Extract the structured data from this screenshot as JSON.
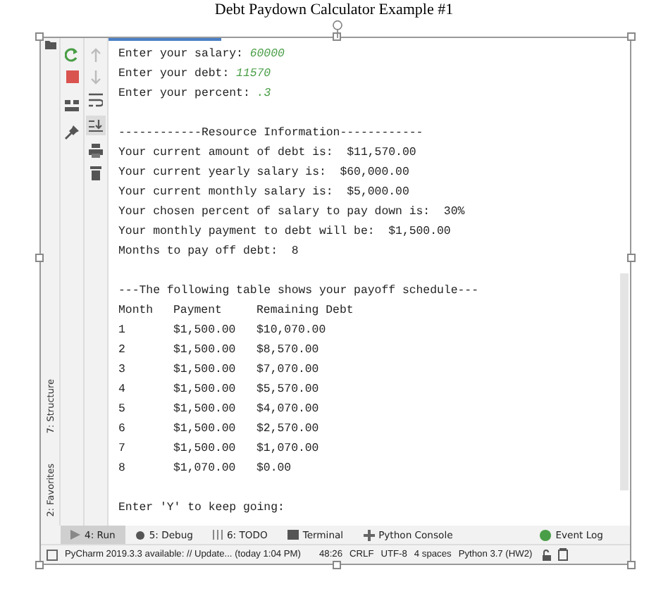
{
  "title": "Debt Paydown Calculator Example #1",
  "side_tabs": [
    {
      "label": "7: Structure"
    },
    {
      "label": "2: Favorites"
    }
  ],
  "console": {
    "lines": [
      {
        "kind": "prompt",
        "text": "Enter your salary: ",
        "input": "60000"
      },
      {
        "kind": "prompt",
        "text": "Enter your debt: ",
        "input": "11570"
      },
      {
        "kind": "prompt",
        "text": "Enter your percent: ",
        "input": ".3"
      },
      {
        "kind": "blank"
      },
      {
        "kind": "output",
        "text": "------------Resource Information------------"
      },
      {
        "kind": "output",
        "text": "Your current amount of debt is:  $11,570.00"
      },
      {
        "kind": "output",
        "text": "Your current yearly salary is:  $60,000.00"
      },
      {
        "kind": "output",
        "text": "Your current monthly salary is:  $5,000.00"
      },
      {
        "kind": "output",
        "text": "Your chosen percent of salary to pay down is:  30%"
      },
      {
        "kind": "output",
        "text": "Your monthly payment to debt will be:  $1,500.00"
      },
      {
        "kind": "output",
        "text": "Months to pay off debt:  8"
      },
      {
        "kind": "blank"
      },
      {
        "kind": "output",
        "text": "---The following table shows your payoff schedule---"
      }
    ],
    "table": {
      "columns": [
        "Month",
        "Payment",
        "Remaining Debt"
      ],
      "rows": [
        [
          "1",
          "$1,500.00",
          "$10,070.00"
        ],
        [
          "2",
          "$1,500.00",
          "$8,570.00"
        ],
        [
          "3",
          "$1,500.00",
          "$7,070.00"
        ],
        [
          "4",
          "$1,500.00",
          "$5,570.00"
        ],
        [
          "5",
          "$1,500.00",
          "$4,070.00"
        ],
        [
          "6",
          "$1,500.00",
          "$2,570.00"
        ],
        [
          "7",
          "$1,500.00",
          "$1,070.00"
        ],
        [
          "8",
          "$1,070.00",
          "$0.00"
        ]
      ]
    },
    "last_prompt": "Enter 'Y' to keep going:"
  },
  "tool_tabs": [
    {
      "label": "4: Run",
      "selected": true
    },
    {
      "label": "5: Debug",
      "selected": false
    },
    {
      "label": "6: TODO",
      "selected": false
    },
    {
      "label": "Terminal",
      "selected": false
    },
    {
      "label": "Python Console",
      "selected": false
    }
  ],
  "event_log": "Event Log",
  "status_bar": {
    "message": "PyCharm 2019.3.3 available: // Update... (today 1:04 PM)",
    "items": [
      "48:26",
      "CRLF",
      "UTF-8",
      "4 spaces",
      "Python 3.7 (HW2)"
    ]
  }
}
